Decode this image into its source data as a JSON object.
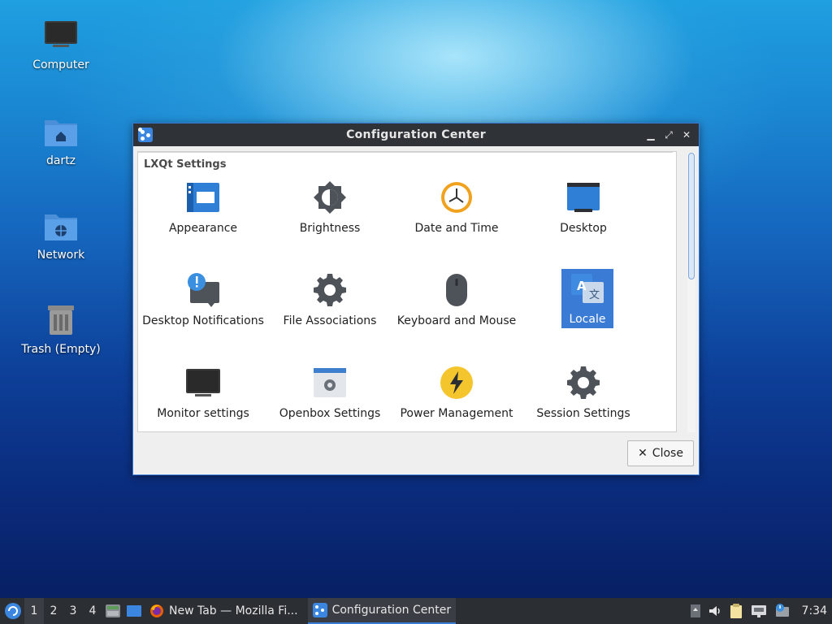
{
  "desktop": {
    "icons": [
      {
        "label": "Computer"
      },
      {
        "label": "dartz"
      },
      {
        "label": "Network"
      },
      {
        "label": "Trash (Empty)"
      }
    ]
  },
  "window": {
    "title": "Configuration Center",
    "group_title": "LXQt Settings",
    "items": [
      {
        "label": "Appearance",
        "icon": "appearance-icon"
      },
      {
        "label": "Brightness",
        "icon": "brightness-icon"
      },
      {
        "label": "Date and Time",
        "icon": "clock-icon"
      },
      {
        "label": "Desktop",
        "icon": "desktop-icon"
      },
      {
        "label": "Desktop Notifications",
        "icon": "notification-icon"
      },
      {
        "label": "File Associations",
        "icon": "gear-icon"
      },
      {
        "label": "Keyboard and Mouse",
        "icon": "mouse-icon"
      },
      {
        "label": "Locale",
        "icon": "translate-icon"
      },
      {
        "label": "Monitor settings",
        "icon": "monitor-icon"
      },
      {
        "label": "Openbox Settings",
        "icon": "openbox-icon"
      },
      {
        "label": "Power Management",
        "icon": "power-icon"
      },
      {
        "label": "Session Settings",
        "icon": "gear-icon"
      }
    ],
    "selected_item": "Locale",
    "close_label": "Close",
    "close_glyph": "✕"
  },
  "taskbar": {
    "workspaces": [
      "1",
      "2",
      "3",
      "4"
    ],
    "active_workspace": "1",
    "tasks": [
      {
        "label": "New Tab — Mozilla Fi...",
        "icon": "firefox-icon"
      },
      {
        "label": "Configuration Center",
        "icon": "config-icon"
      }
    ],
    "clock": "7:34"
  },
  "colors": {
    "accent": "#3a7bd5",
    "titlebar": "#2f3237",
    "taskbar": "#2b2e33"
  }
}
